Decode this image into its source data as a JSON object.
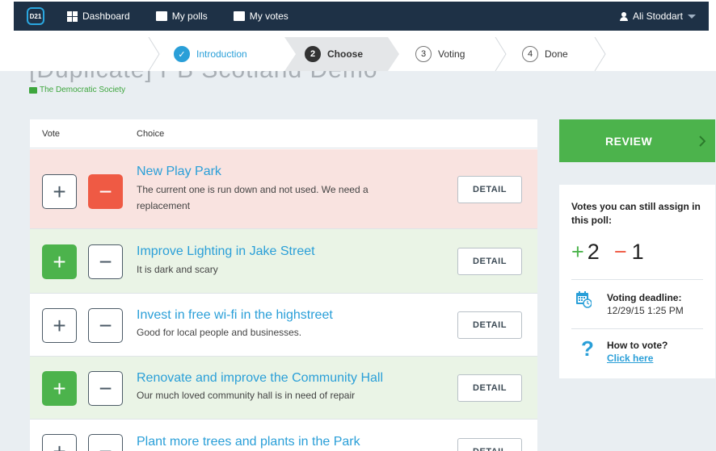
{
  "nav": {
    "logo": "D21",
    "links": [
      {
        "label": "Dashboard",
        "icon": "grid-icon"
      },
      {
        "label": "My polls",
        "icon": "speech-bubble-icon"
      },
      {
        "label": "My votes",
        "icon": "ballot-icon"
      }
    ],
    "user": "Ali Stoddart"
  },
  "steps": [
    {
      "num": "✓",
      "label": "Introduction",
      "state": "done"
    },
    {
      "num": "2",
      "label": "Choose",
      "state": "active"
    },
    {
      "num": "3",
      "label": "Voting",
      "state": "todo"
    },
    {
      "num": "4",
      "label": "Done",
      "state": "todo"
    }
  ],
  "poll": {
    "title": "[Duplicate] PB Scotland Demo",
    "organization": "The Democratic Society"
  },
  "table": {
    "col_vote": "Vote",
    "col_choice": "Choice",
    "detail_label": "DETAIL",
    "rows": [
      {
        "title": "New Play Park",
        "desc": "The current one is run down and not used. We need a replacement",
        "vote": "minus"
      },
      {
        "title": "Improve Lighting in Jake Street",
        "desc": "It is dark and scary",
        "vote": "plus"
      },
      {
        "title": "Invest in free wi-fi in the highstreet",
        "desc": "Good for local people and businesses.",
        "vote": "none"
      },
      {
        "title": "Renovate and improve the Community Hall",
        "desc": "Our much loved community hall is in need of repair",
        "vote": "plus"
      },
      {
        "title": "Plant more trees and plants in the Park",
        "desc": "",
        "vote": "none"
      }
    ]
  },
  "sidebar": {
    "review_label": "REVIEW",
    "votes_heading": "Votes you can still assign in this poll:",
    "plus_sign": "+",
    "plus_count": "2",
    "minus_sign": "−",
    "minus_count": "1",
    "deadline_label": "Voting deadline:",
    "deadline_value": "12/29/15 1:25 PM",
    "howto_label": "How to vote?",
    "howto_link": "Click here"
  },
  "colors": {
    "nav_bg": "#1e3146",
    "accent_blue": "#2a9fd8",
    "green": "#4cb34c",
    "red": "#ef5a44"
  }
}
